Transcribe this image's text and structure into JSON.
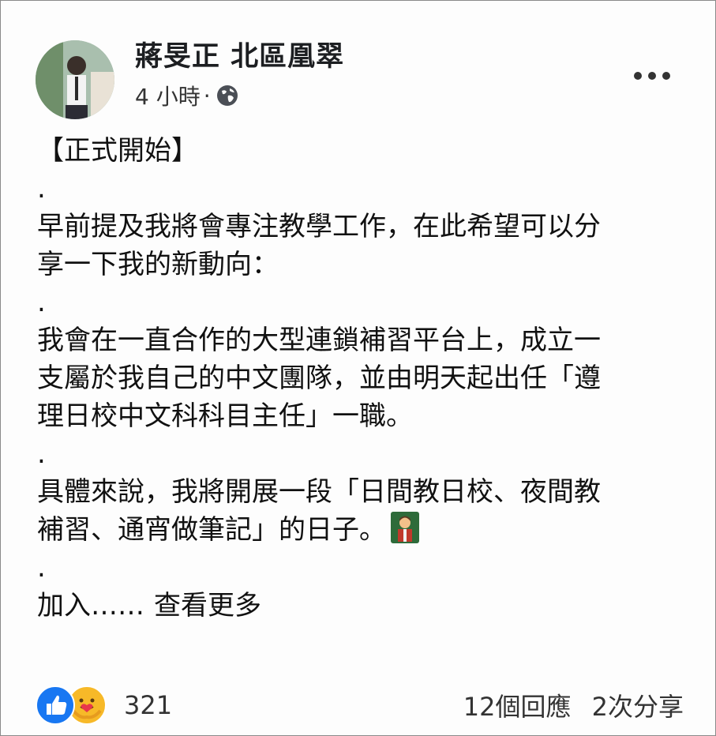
{
  "post": {
    "author": "蔣旻正 北區凰翠",
    "time": "4 小時",
    "separator": "·",
    "privacy_icon": "globe-icon",
    "menu_icon": "more-icon"
  },
  "body": {
    "lines": [
      "【正式開始】",
      ".",
      "早前提及我將會專注教學工作，在此希望可以分",
      "享一下我的新動向：",
      ".",
      "我會在一直合作的大型連鎖補習平台上，成立一",
      "支屬於我自己的中文團隊，並由明天起出任「遵",
      "理日校中文科科目主任」一職。",
      ".",
      "具體來說，我將開展一段「日間教日校、夜間教",
      "補習、通宵做筆記」的日子。",
      ".",
      "加入……"
    ],
    "emoji_icon": "teacher-emoji-icon",
    "see_more": "查看更多"
  },
  "footer": {
    "reaction_icons": [
      "like-icon",
      "care-icon"
    ],
    "reactions_count": "321",
    "comments": "12個回應",
    "shares": "2次分享"
  },
  "colors": {
    "like": "#1877f2",
    "care": "#f7b928",
    "text": "#111111"
  }
}
